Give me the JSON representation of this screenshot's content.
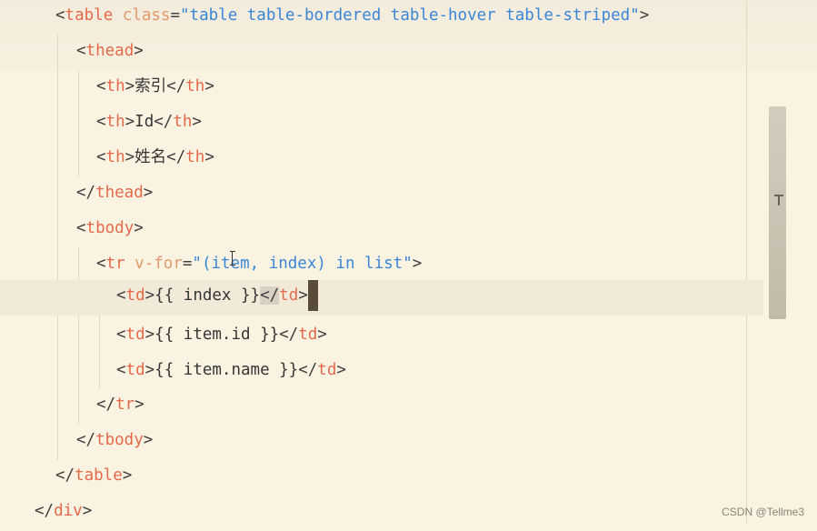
{
  "code": {
    "l1": {
      "open": "<",
      "tag": "table",
      "sp": " ",
      "attr": "class",
      "eq": "=",
      "str": "\"table table-bordered table-hover table-striped\"",
      "close": ">"
    },
    "l2": {
      "open": "<",
      "tag": "thead",
      "close": ">"
    },
    "l3": {
      "open": "<",
      "tag": "th",
      "close": ">",
      "text": "索引",
      "open2": "</",
      "tag2": "th",
      "close2": ">"
    },
    "l4": {
      "open": "<",
      "tag": "th",
      "close": ">",
      "text": "Id",
      "open2": "</",
      "tag2": "th",
      "close2": ">"
    },
    "l5": {
      "open": "<",
      "tag": "th",
      "close": ">",
      "text": "姓名",
      "open2": "</",
      "tag2": "th",
      "close2": ">"
    },
    "l6": {
      "open": "</",
      "tag": "thead",
      "close": ">"
    },
    "l7": {
      "open": "<",
      "tag": "tbody",
      "close": ">"
    },
    "l8": {
      "open": "<",
      "tag": "tr",
      "sp": " ",
      "attr": "v-for",
      "eq": "=",
      "str": "\"(item, index) in list\"",
      "close": ">"
    },
    "l9": {
      "open": "<",
      "tag": "td",
      "close": ">",
      "text": "{{ index }}",
      "open2": "</",
      "tag2": "td",
      "close2": ">"
    },
    "l10": {
      "open": "<",
      "tag": "td",
      "close": ">",
      "text": "{{ item.id }}",
      "open2": "</",
      "tag2": "td",
      "close2": ">"
    },
    "l11": {
      "open": "<",
      "tag": "td",
      "close": ">",
      "text": "{{ item.name }}",
      "open2": "</",
      "tag2": "td",
      "close2": ">"
    },
    "l12": {
      "open": "</",
      "tag": "tr",
      "close": ">"
    },
    "l13": {
      "open": "</",
      "tag": "tbody",
      "close": ">"
    },
    "l14": {
      "open": "</",
      "tag": "table",
      "close": ">"
    },
    "l15": {
      "open": "</",
      "tag": "div",
      "close": ">"
    }
  },
  "watermark": "CSDN @Tellme3",
  "colors": {
    "background": "#fbf3e2",
    "tag": "#e46a4b",
    "attribute": "#e39b6d",
    "string": "#3a86d7",
    "text": "#353535"
  }
}
